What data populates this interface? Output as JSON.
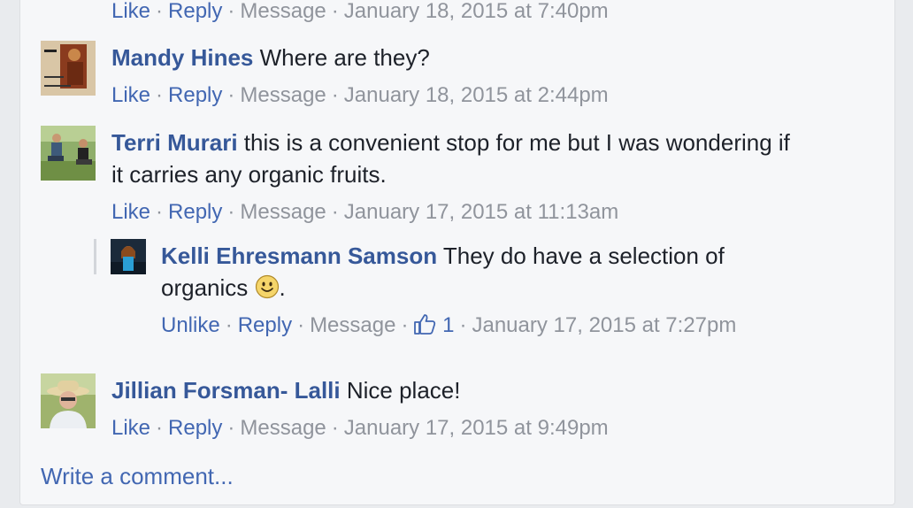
{
  "top_actions": {
    "like": "Like",
    "reply": "Reply",
    "message": "Message",
    "time": "January 18, 2015 at 7:40pm"
  },
  "comments": [
    {
      "name": "Mandy Hines",
      "text": "Where are they?",
      "actions": {
        "like": "Like",
        "reply": "Reply",
        "message": "Message",
        "time": "January 18, 2015 at 2:44pm"
      }
    },
    {
      "name": "Terri Murari",
      "text": "this is a convenient stop for me but I was wondering if",
      "text2": "it carries any organic fruits.",
      "actions": {
        "like": "Like",
        "reply": "Reply",
        "message": "Message",
        "time": "January 17, 2015 at 11:13am"
      },
      "reply": {
        "name": "Kelli Ehresmann Samson",
        "text": "They do have a selection of",
        "text2": "organics",
        "text2_end": ".",
        "actions": {
          "unlike": "Unlike",
          "reply": "Reply",
          "message": "Message",
          "likes": "1",
          "time": "January 17, 2015 at 7:27pm"
        }
      }
    },
    {
      "name": "Jillian Forsman- Lalli",
      "text": "Nice place!",
      "actions": {
        "like": "Like",
        "reply": "Reply",
        "message": "Message",
        "time": "January 17, 2015 at 9:49pm"
      }
    }
  ],
  "write_comment": "Write a comment...",
  "colors": {
    "link": "#4267b2",
    "name": "#365899",
    "meta": "#90949c",
    "panel_bg": "#f6f7f9",
    "page_bg": "#e9ebee"
  },
  "icons": [
    "thumbs-up-icon",
    "smiley-emoji"
  ]
}
